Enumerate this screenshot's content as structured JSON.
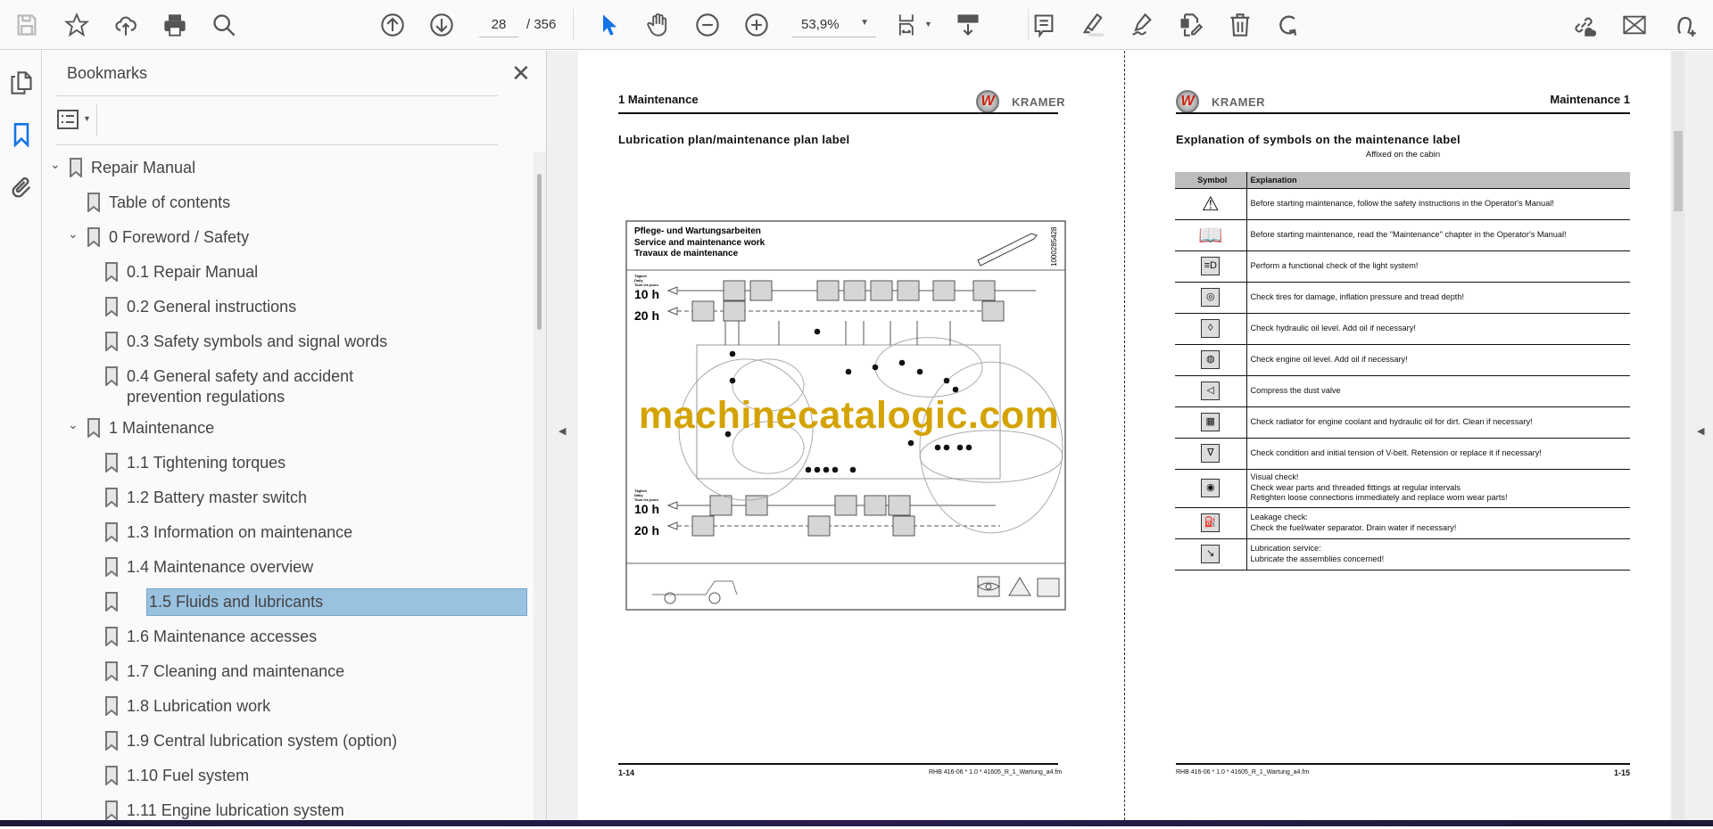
{
  "toolbar": {
    "current_page": "28",
    "total_pages": "/ 356",
    "zoom_level": "53,9%"
  },
  "sidebar": {
    "title": "Bookmarks",
    "items": [
      {
        "label": "Repair Manual",
        "level": 0,
        "expanded": true
      },
      {
        "label": "Table of contents",
        "level": 1
      },
      {
        "label": "0 Foreword / Safety",
        "level": 1,
        "expanded": true
      },
      {
        "label": "0.1 Repair Manual",
        "level": 2
      },
      {
        "label": "0.2 General instructions",
        "level": 2
      },
      {
        "label": "0.3 Safety symbols and signal words",
        "level": 2
      },
      {
        "label": "0.4 General safety and accident prevention regulations",
        "level": 2
      },
      {
        "label": "1 Maintenance",
        "level": 1,
        "expanded": true
      },
      {
        "label": "1.1 Tightening torques",
        "level": 2
      },
      {
        "label": "1.2 Battery master switch",
        "level": 2
      },
      {
        "label": "1.3 Information on maintenance",
        "level": 2
      },
      {
        "label": "1.4 Maintenance overview",
        "level": 2
      },
      {
        "label": "1.5 Fluids and lubricants",
        "level": 2,
        "selected": true
      },
      {
        "label": "1.6 Maintenance accesses",
        "level": 2
      },
      {
        "label": "1.7 Cleaning and maintenance",
        "level": 2
      },
      {
        "label": "1.8 Lubrication work",
        "level": 2
      },
      {
        "label": "1.9 Central lubrication system (option)",
        "level": 2
      },
      {
        "label": "1.10 Fuel system",
        "level": 2
      },
      {
        "label": "1.11 Engine lubrication system",
        "level": 2
      }
    ]
  },
  "left_page": {
    "chapter": "1  Maintenance",
    "brand": "KRAMER",
    "title": "Lubrication plan/maintenance plan label",
    "diagram": {
      "heading_de": "Pflege- und Wartungsarbeiten",
      "heading_en": "Service and maintenance work",
      "heading_fr": "Travaux de maintenance",
      "part_number": "1000285428",
      "daily_de": "Täglich",
      "daily_en": "Daily",
      "daily_fr": "Tous les jours",
      "interval_10": "10 h",
      "interval_20": "20 h"
    },
    "page_number": "1-14",
    "footer_code": "RHB 416-06 * 1.0 * 41605_R_1_Wartung_a4.fm"
  },
  "right_page": {
    "chapter": "Maintenance  1",
    "brand": "KRAMER",
    "title": "Explanation of symbols on the maintenance label",
    "subtitle": "Affixed on the cabin",
    "table_headers": [
      "Symbol",
      "Explanation"
    ],
    "rows": [
      {
        "symbol": "warning-triangle",
        "text": "Before starting maintenance, follow the safety instructions in the Operator's Manual!"
      },
      {
        "symbol": "open-book",
        "text": "Before starting maintenance, read the \"Maintenance\" chapter in the Operator's Manual!"
      },
      {
        "symbol": "headlight",
        "text": "Perform a functional check of the light system!"
      },
      {
        "symbol": "tire",
        "text": "Check tires for damage, inflation pressure and tread depth!"
      },
      {
        "symbol": "hydraulic-oil",
        "text": "Check hydraulic oil level. Add oil if necessary!"
      },
      {
        "symbol": "engine-oil",
        "text": "Check engine oil level. Add oil if necessary!"
      },
      {
        "symbol": "dust-valve",
        "text": "Compress the dust valve"
      },
      {
        "symbol": "radiator",
        "text": "Check radiator for engine coolant and hydraulic oil for dirt. Clean if necessary!"
      },
      {
        "symbol": "v-belt",
        "text": "Check condition and initial tension of V-belt. Retension or replace it if necessary!"
      },
      {
        "symbol": "eye",
        "text": "Visual check!\nCheck wear parts and threaded fittings at regular intervals\nRetighten loose connections immediately and replace worn wear parts!"
      },
      {
        "symbol": "fuel-pump",
        "text": "Leakage check:\nCheck the fuel/water separator. Drain water if necessary!"
      },
      {
        "symbol": "grease-gun",
        "text": "Lubrication service:\nLubricate the assemblies concerned!"
      }
    ],
    "page_number": "1-15",
    "footer_code": "RHB 416-06 * 1.0 * 41605_R_1_Wartung_a4.fm"
  },
  "watermark": "machinecatalogic.com",
  "colors": {
    "accent": "#1473e6",
    "selection": "#99c1e0",
    "watermark": "#d4a300"
  }
}
